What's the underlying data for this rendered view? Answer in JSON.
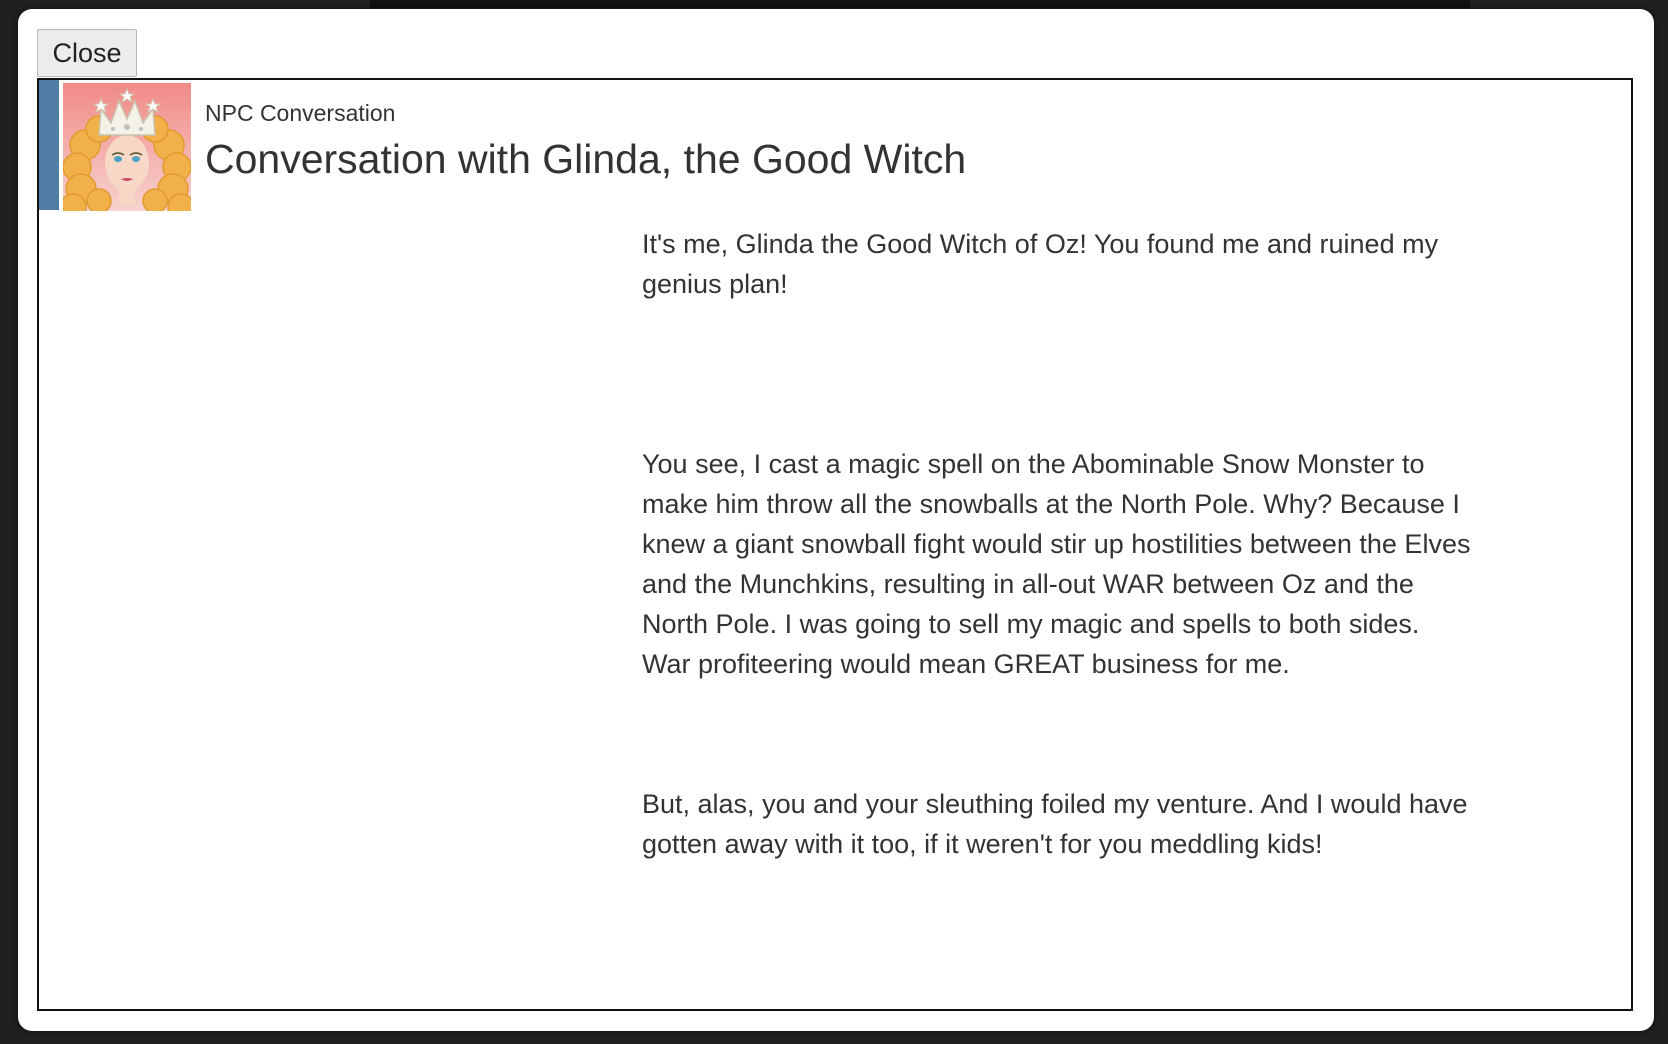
{
  "dialog": {
    "close_label": "Close"
  },
  "header": {
    "subtitle": "NPC Conversation",
    "title": "Conversation with Glinda, the Good Witch",
    "avatar_icon": "glinda-portrait-icon"
  },
  "messages": [
    "It's me, Glinda the Good Witch of Oz! You found me and ruined my genius plan!",
    "You see, I cast a magic spell on the Abominable Snow Monster to make him throw all the snowballs at the North Pole. Why? Because I knew a giant snowball fight would stir up hostilities between the Elves and the Munchkins, resulting in all-out WAR between Oz and the North Pole. I was going to sell my magic and spells to both sides. War profiteering would mean GREAT business for me.",
    "But, alas, you and your sleuthing foiled my venture. And I would have gotten away with it too, if it weren't for you meddling kids!"
  ],
  "colors": {
    "accent": "#4f7da3",
    "panel_border": "#111111",
    "text": "#333333"
  }
}
